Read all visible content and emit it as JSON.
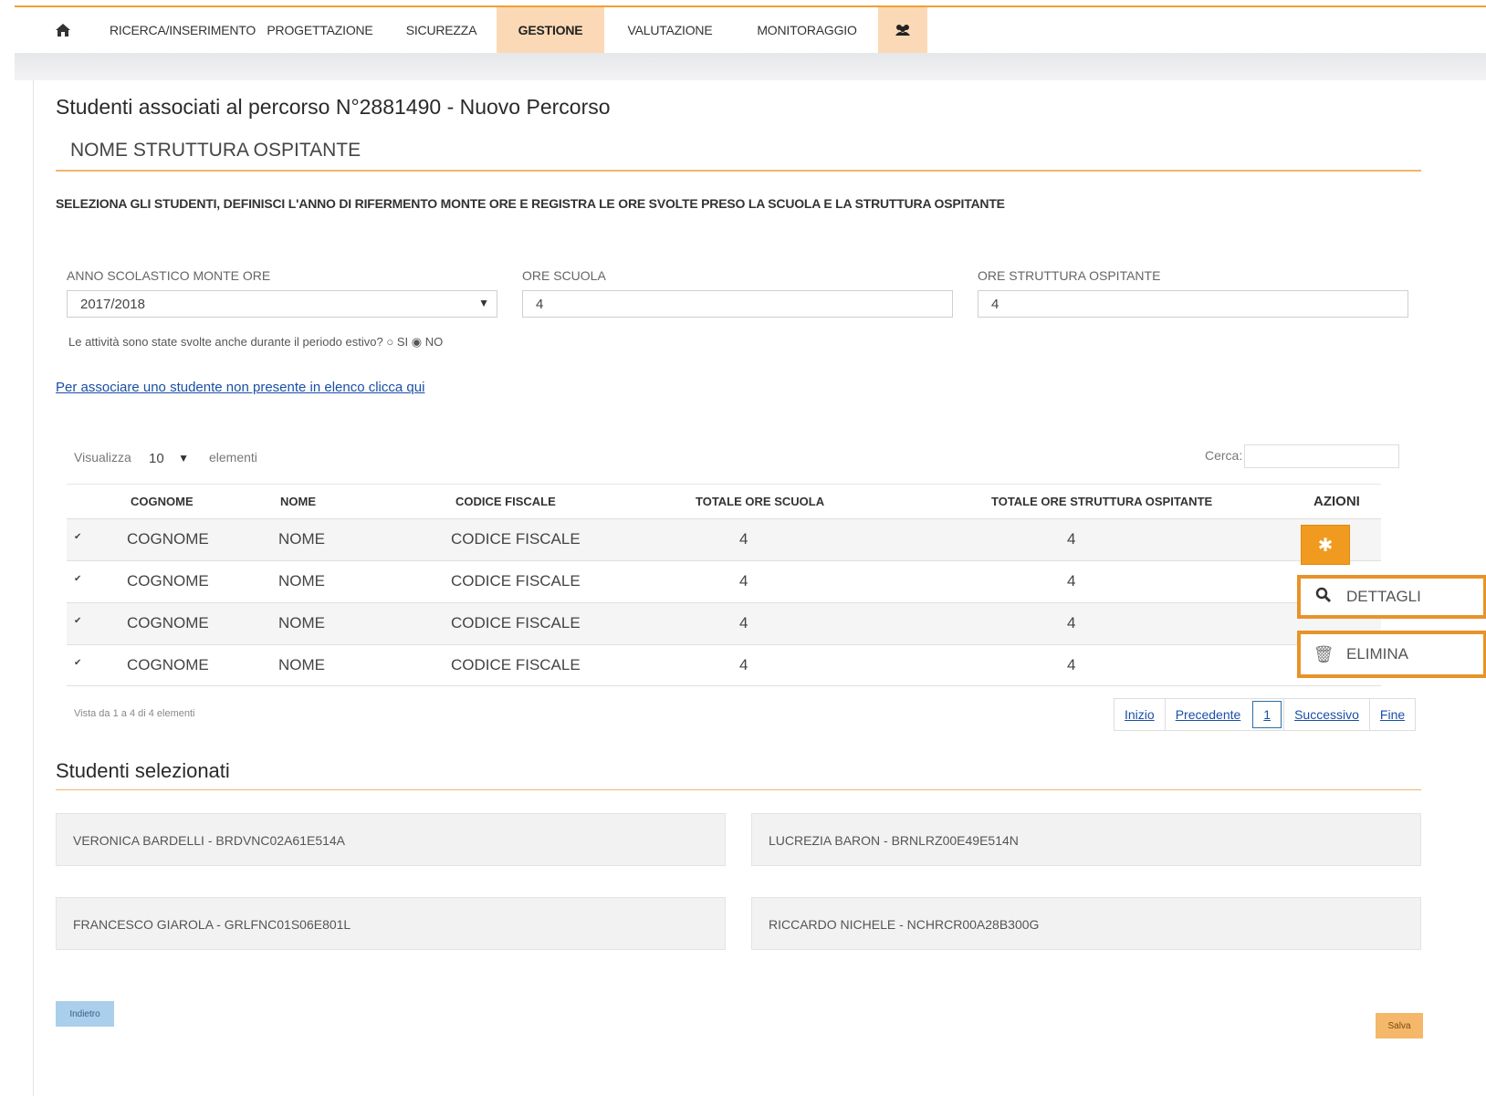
{
  "nav": {
    "home_icon": "home-icon",
    "items": [
      {
        "label": "RICERCA/INSERIMENTO"
      },
      {
        "label": "PROGETTAZIONE"
      },
      {
        "label": "SICUREZZA"
      },
      {
        "label": "GESTIONE"
      },
      {
        "label": "VALUTAZIONE"
      },
      {
        "label": "MONITORAGGIO"
      }
    ],
    "active": "GESTIONE",
    "people_icon": "users-icon"
  },
  "page": {
    "title": "Studenti associati al percorso N°2881490 - Nuovo Percorso",
    "subtitle": "NOME STRUTTURA OSPITANTE",
    "instructions": "SELEZIONA GLI STUDENTI, DEFINISCI L'ANNO DI RIFERMENTO MONTE ORE E REGISTRA LE ORE SVOLTE PRESO LA SCUOLA E LA STRUTTURA OSPITANTE"
  },
  "form": {
    "anno_label": "ANNO SCOLASTICO MONTE ORE",
    "anno_value": "2017/2018",
    "ore_scuola_label": "ORE SCUOLA",
    "ore_scuola_value": "4",
    "ore_struttura_label": "ORE STRUTTURA OSPITANTE",
    "ore_struttura_value": "4",
    "summer_question": "Le attività sono state svolte anche durante il periodo estivo?",
    "summer_yes": "SI",
    "summer_no": "NO",
    "summer_selected": "NO",
    "add_student_link": "Per associare uno studente non presente in elenco clicca qui"
  },
  "table_controls": {
    "show_label": "Visualizza",
    "show_value": "10",
    "elements_label": "elementi",
    "search_label": "Cerca:"
  },
  "table": {
    "headers": [
      "COGNOME",
      "NOME",
      "CODICE FISCALE",
      "TOTALE ORE SCUOLA",
      "TOTALE ORE STRUTTURA OSPITANTE",
      "AZIONI"
    ],
    "rows": [
      {
        "checked": true,
        "cognome": "COGNOME",
        "nome": "NOME",
        "cf": "CODICE FISCALE",
        "ore_scuola": "4",
        "ore_struttura": "4"
      },
      {
        "checked": true,
        "cognome": "COGNOME",
        "nome": "NOME",
        "cf": "CODICE FISCALE",
        "ore_scuola": "4",
        "ore_struttura": "4"
      },
      {
        "checked": true,
        "cognome": "COGNOME",
        "nome": "NOME",
        "cf": "CODICE FISCALE",
        "ore_scuola": "4",
        "ore_struttura": "4"
      },
      {
        "checked": true,
        "cognome": "COGNOME",
        "nome": "NOME",
        "cf": "CODICE FISCALE",
        "ore_scuola": "4",
        "ore_struttura": "4"
      }
    ],
    "actions_menu": [
      {
        "icon": "search-icon",
        "label": "DETTAGLI"
      },
      {
        "icon": "trash-icon",
        "label": "ELIMINA"
      }
    ],
    "info": "Vista da 1 a 4 di 4 elementi"
  },
  "pagination": {
    "first": "Inizio",
    "prev": "Precedente",
    "current": "1",
    "next": "Successivo",
    "last": "Fine"
  },
  "selected": {
    "title": "Studenti selezionati",
    "students": [
      "VERONICA BARDELLI - BRDVNC02A61E514A",
      "LUCREZIA BARON - BRNLRZ00E49E514N",
      "FRANCESCO GIAROLA - GRLFNC01S06E801L",
      "RICCARDO NICHELE - NCHRCR00A28B300G"
    ]
  },
  "buttons": {
    "back": "Indietro",
    "save": "Salva"
  },
  "colors": {
    "accent": "#f09a1f",
    "nav_active": "#fbd9b6",
    "link": "#1a4fa8"
  }
}
